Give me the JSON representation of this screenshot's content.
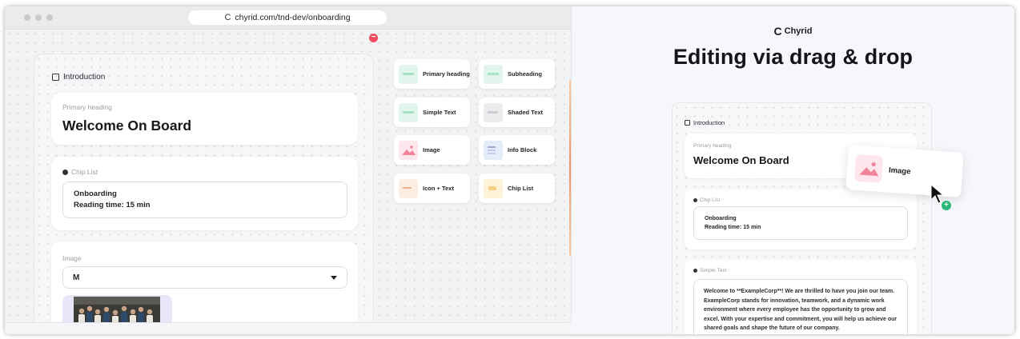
{
  "browser": {
    "url": "chyrid.com/tnd-dev/onboarding"
  },
  "editor": {
    "section_title": "Introduction",
    "primary_heading": {
      "label": "Primary heading",
      "value": "Welcome On Board"
    },
    "chip_list": {
      "label": "Chip List",
      "line1": "Onboarding",
      "line2": "Reading time: 15 min"
    },
    "image": {
      "label": "Image",
      "size_value": "M"
    }
  },
  "palette": {
    "items": [
      {
        "label": "Primary heading",
        "icon": "primary-heading-icon",
        "color": "green"
      },
      {
        "label": "Subheading",
        "icon": "subheading-icon",
        "color": "green"
      },
      {
        "label": "Simple Text",
        "icon": "simple-text-icon",
        "color": "green"
      },
      {
        "label": "Shaded Text",
        "icon": "shaded-text-icon",
        "color": "gray"
      },
      {
        "label": "Image",
        "icon": "image-icon",
        "color": "pink"
      },
      {
        "label": "Info Block",
        "icon": "info-block-icon",
        "color": "blue"
      },
      {
        "label": "Icon + Text",
        "icon": "icon-text-icon",
        "color": "peach"
      },
      {
        "label": "Chip List",
        "icon": "chip-list-icon",
        "color": "yellow"
      }
    ]
  },
  "promo": {
    "brand": "Chyrid",
    "headline": "Editing via drag & drop",
    "section_title": "Introduction",
    "primary_heading": {
      "label": "Primary heading",
      "value": "Welcome On Board"
    },
    "chip_list": {
      "label": "Chip List",
      "line1": "Onboarding",
      "line2": "Reading time: 15 min"
    },
    "simple_text": {
      "label": "Simple Text",
      "value": "Welcome to **ExampleCorp**! We are thrilled to have you join our team. ExampleCorp stands for innovation, teamwork, and a dynamic work environment where every employee has the opportunity to grow and excel. With your expertise and commitment, you will help us achieve our shared goals and shape the future of our company."
    },
    "dragged_item": "Image"
  },
  "colors": {
    "accent_red": "#ef4c5f",
    "accent_green": "#27b878",
    "scroll_orange": "#ed9867"
  }
}
